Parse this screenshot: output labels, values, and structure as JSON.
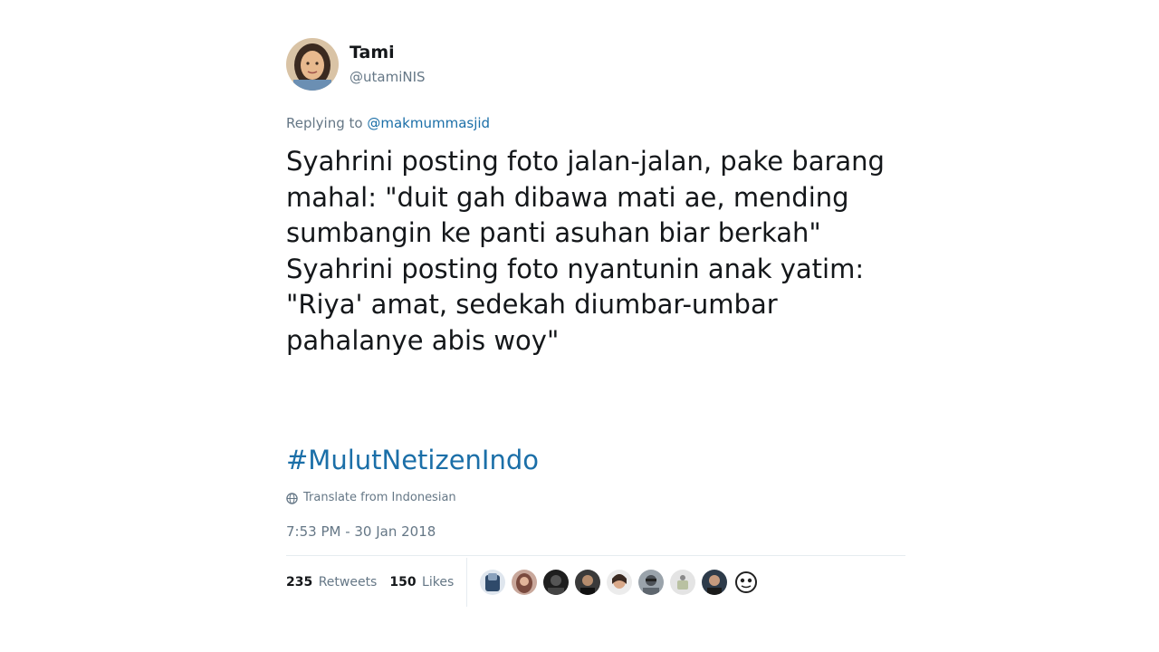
{
  "user": {
    "name": "Tami",
    "handle": "@utamiNIS"
  },
  "reply": {
    "prefix": "Replying to",
    "mention": "@makmummasjid"
  },
  "tweet": {
    "lines": [
      "Syahrini posting foto jalan-jalan, pake barang",
      "mahal: \"duit gah dibawa mati ae, mending",
      "sumbangin ke panti asuhan biar berkah\"",
      "Syahrini posting foto nyantunin anak yatim:",
      "\"Riya' amat, sedekah diumbar-umbar",
      "pahalanye abis woy\""
    ],
    "hashtag": "#MulutNetizenIndo"
  },
  "translate_label": "Translate from Indonesian",
  "timestamp": "7:53 PM - 30 Jan 2018",
  "stats": {
    "retweets_count": "235",
    "retweets_label": "Retweets",
    "likes_count": "150",
    "likes_label": "Likes"
  },
  "colors": {
    "link": "#1b6fa8",
    "muted": "#657786",
    "text": "#14171a"
  }
}
